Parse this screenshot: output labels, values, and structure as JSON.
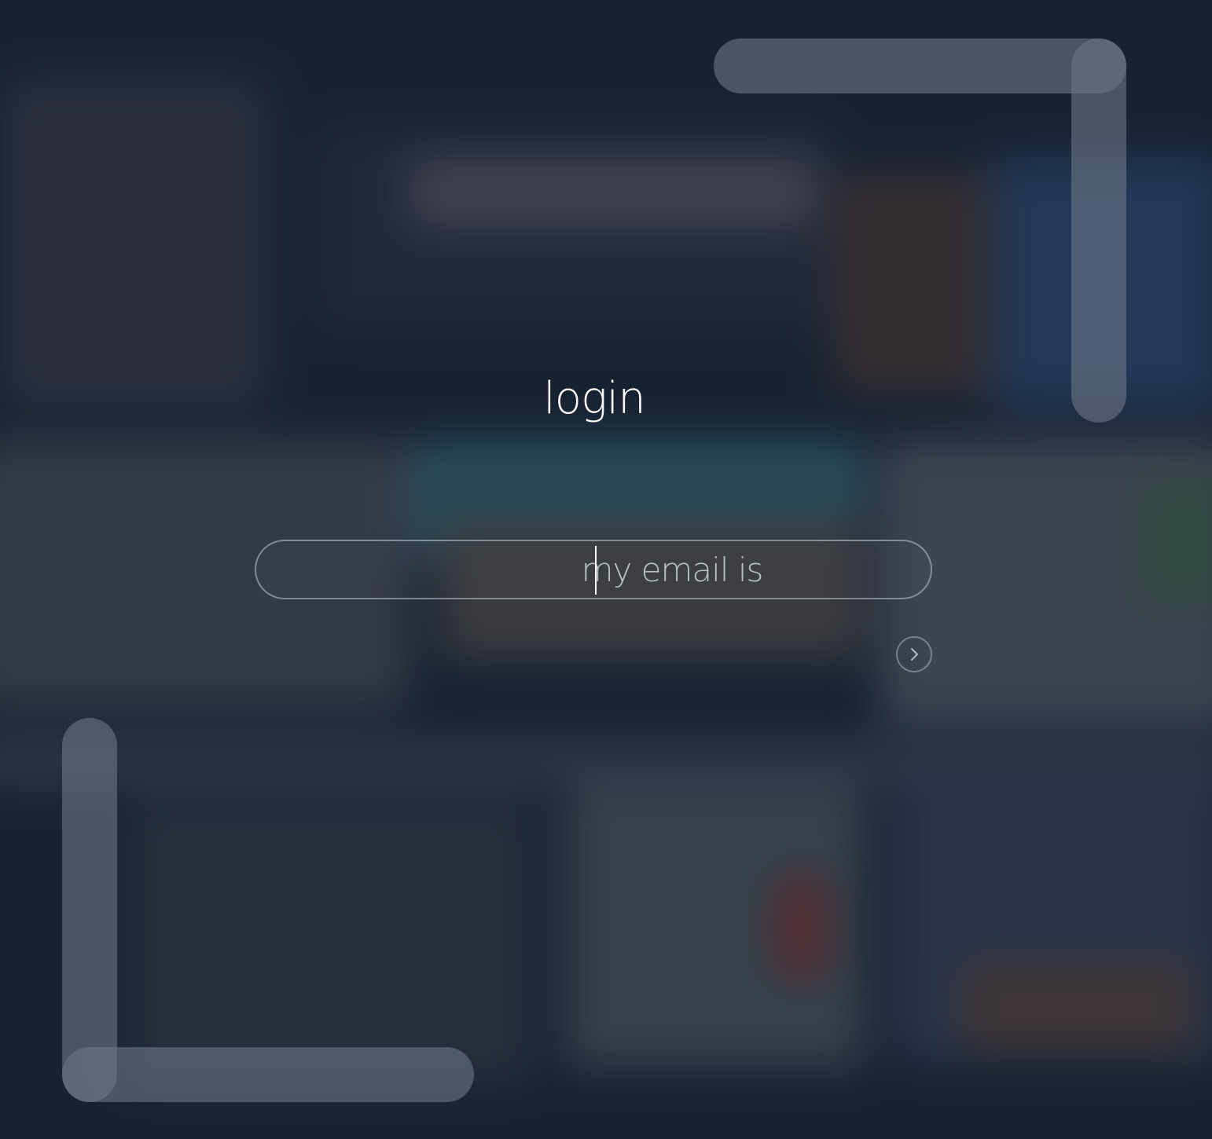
{
  "login": {
    "title": "login",
    "email_placeholder": "my email is",
    "email_value": ""
  },
  "icons": {
    "next": "chevron-right-icon"
  },
  "colors": {
    "background": "#1a2535",
    "bracket": "#5d6878",
    "text": "#ffffff"
  }
}
